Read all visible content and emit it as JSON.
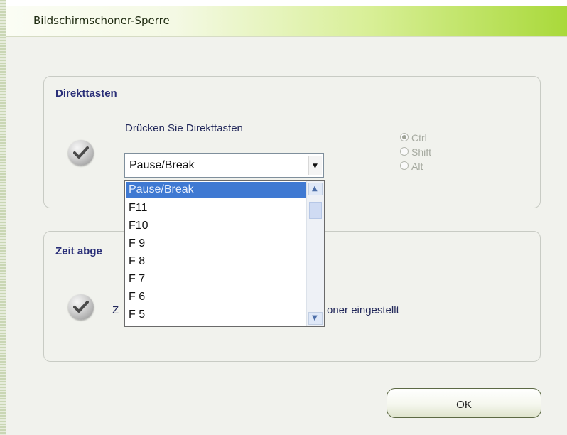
{
  "window": {
    "title": "Bildschirmschoner-Sperre"
  },
  "hotkeys": {
    "group_title": "Direkttasten",
    "prompt": "Drücken Sie Direkttasten",
    "selected_key": "Pause/Break",
    "modifiers": [
      {
        "label": "Ctrl",
        "selected": true
      },
      {
        "label": "Shift",
        "selected": false
      },
      {
        "label": "Alt",
        "selected": false
      }
    ]
  },
  "dropdown": {
    "options": [
      "Pause/Break",
      "F11",
      "F10",
      "F 9",
      "F 8",
      "F 7",
      "F 6",
      "F 5"
    ],
    "highlighted_index": 0
  },
  "timeout": {
    "group_title_visible": "Zeit abge",
    "text_left": "Z",
    "text_right": "oner eingestellt"
  },
  "buttons": {
    "ok": "OK"
  },
  "icons": {
    "check": "check-icon",
    "dropdown_arrow": "chevron-down-icon",
    "scroll_up": "chevron-up-icon",
    "scroll_down": "chevron-down-icon"
  }
}
